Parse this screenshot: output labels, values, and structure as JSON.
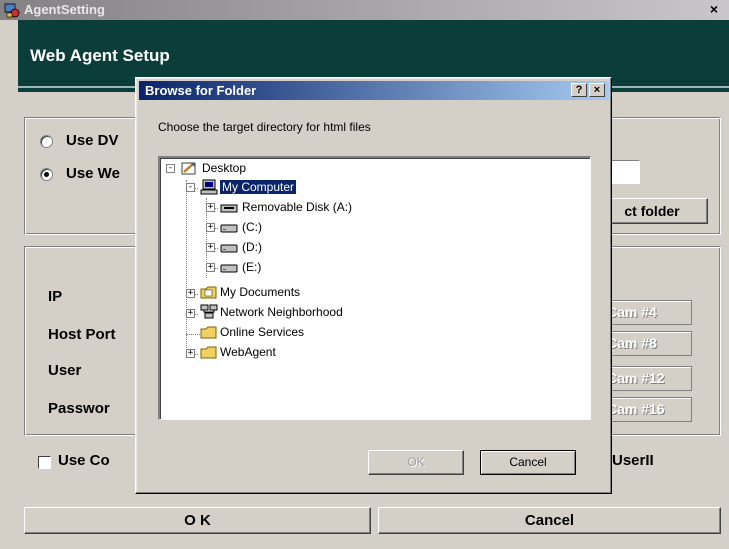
{
  "main_window": {
    "title": "AgentSetting",
    "close_glyph": "×",
    "header_title": "Web Agent Setup",
    "options": [
      {
        "label": "Use DV",
        "selected": false
      },
      {
        "label": "Use We",
        "selected": true
      }
    ],
    "select_folder_label": "ct folder",
    "fields": [
      {
        "label": "IP"
      },
      {
        "label": "Host Port"
      },
      {
        "label": "User"
      },
      {
        "label": "Passwor"
      }
    ],
    "cam_buttons": [
      "Cam #4",
      "Cam #8",
      "Cam #12",
      "Cam #16"
    ],
    "use_checkbox_label": "Use Co",
    "use_checkbox_checked": false,
    "right_label": "UserII",
    "ok_label": "O K",
    "cancel_label": "Cancel"
  },
  "browse_dialog": {
    "title": "Browse for Folder",
    "help_glyph": "?",
    "close_glyph": "×",
    "prompt": "Choose the target directory for html files",
    "tree": [
      {
        "label": "Desktop",
        "icon": "desktop-icon",
        "level": 0,
        "expander": "-"
      },
      {
        "label": "My Computer",
        "icon": "computer-icon",
        "level": 1,
        "expander": "-",
        "selected": true
      },
      {
        "label": "Removable Disk (A:)",
        "icon": "floppy-drive-icon",
        "level": 2,
        "expander": "+"
      },
      {
        "label": "(C:)",
        "icon": "hard-drive-icon",
        "level": 2,
        "expander": "+"
      },
      {
        "label": "(D:)",
        "icon": "hard-drive-icon",
        "level": 2,
        "expander": "+"
      },
      {
        "label": "(E:)",
        "icon": "hard-drive-icon",
        "level": 2,
        "expander": "+"
      },
      {
        "label": "My Documents",
        "icon": "documents-folder-icon",
        "level": 1,
        "expander": "+"
      },
      {
        "label": "Network Neighborhood",
        "icon": "network-icon",
        "level": 1,
        "expander": "+"
      },
      {
        "label": "Online Services",
        "icon": "folder-icon",
        "level": 1,
        "expander": ""
      },
      {
        "label": "WebAgent",
        "icon": "folder-icon",
        "level": 1,
        "expander": "+"
      }
    ],
    "ok_label": "OK",
    "ok_enabled": false,
    "cancel_label": "Cancel"
  },
  "colors": {
    "header_bg": "#0b3e3a",
    "dialog_title_start": "#0a246a",
    "dialog_title_end": "#a6caf0",
    "selection": "#0a246a"
  }
}
